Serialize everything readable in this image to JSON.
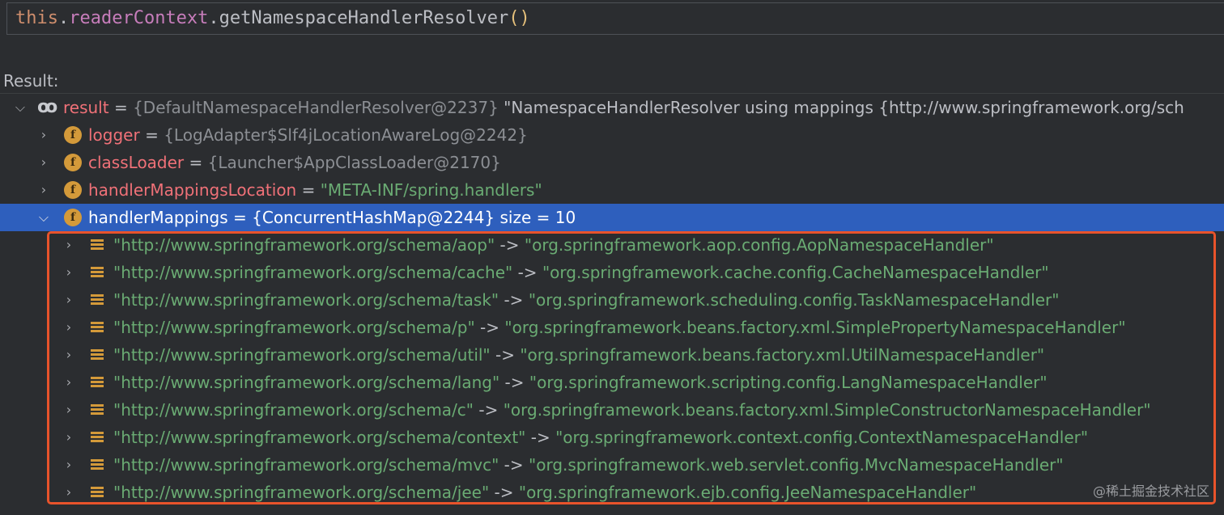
{
  "expression": {
    "this_kw": "this",
    "dot1": ".",
    "field": "readerContext",
    "dot2": ".",
    "method": "getNamespaceHandlerResolver",
    "parens": "()"
  },
  "result_label": "Result:",
  "root": {
    "name": "result",
    "eq": " = ",
    "ref": "{DefaultNamespaceHandlerResolver@2237}",
    "value": " \"NamespaceHandlerResolver using mappings {http://www.springframework.org/sch"
  },
  "fields": [
    {
      "name": "logger",
      "eq": " = ",
      "value": "{LogAdapter$Slf4jLocationAwareLog@2242}",
      "value_style": "gray"
    },
    {
      "name": "classLoader",
      "eq": " = ",
      "value": "{Launcher$AppClassLoader@2170}",
      "value_style": "gray"
    },
    {
      "name": "handlerMappingsLocation",
      "eq": " = ",
      "value": "\"META-INF/spring.handlers\"",
      "value_style": "green"
    }
  ],
  "selected": {
    "name": "handlerMappings",
    "eq": " = ",
    "ref": "{ConcurrentHashMap@2244}",
    "size": "  size = 10"
  },
  "entries": [
    {
      "key": "\"http://www.springframework.org/schema/aop\"",
      "arrow": " -> ",
      "value": "\"org.springframework.aop.config.AopNamespaceHandler\""
    },
    {
      "key": "\"http://www.springframework.org/schema/cache\"",
      "arrow": " -> ",
      "value": "\"org.springframework.cache.config.CacheNamespaceHandler\""
    },
    {
      "key": "\"http://www.springframework.org/schema/task\"",
      "arrow": " -> ",
      "value": "\"org.springframework.scheduling.config.TaskNamespaceHandler\""
    },
    {
      "key": "\"http://www.springframework.org/schema/p\"",
      "arrow": " -> ",
      "value": "\"org.springframework.beans.factory.xml.SimplePropertyNamespaceHandler\""
    },
    {
      "key": "\"http://www.springframework.org/schema/util\"",
      "arrow": " -> ",
      "value": "\"org.springframework.beans.factory.xml.UtilNamespaceHandler\""
    },
    {
      "key": "\"http://www.springframework.org/schema/lang\"",
      "arrow": " -> ",
      "value": "\"org.springframework.scripting.config.LangNamespaceHandler\""
    },
    {
      "key": "\"http://www.springframework.org/schema/c\"",
      "arrow": " -> ",
      "value": "\"org.springframework.beans.factory.xml.SimpleConstructorNamespaceHandler\""
    },
    {
      "key": "\"http://www.springframework.org/schema/context\"",
      "arrow": " -> ",
      "value": "\"org.springframework.context.config.ContextNamespaceHandler\""
    },
    {
      "key": "\"http://www.springframework.org/schema/mvc\"",
      "arrow": " -> ",
      "value": "\"org.springframework.web.servlet.config.MvcNamespaceHandler\""
    },
    {
      "key": "\"http://www.springframework.org/schema/jee\"",
      "arrow": " -> ",
      "value": "\"org.springframework.ejb.config.JeeNamespaceHandler\""
    }
  ],
  "icons": {
    "expand": "chevron-right-icon",
    "collapse": "chevron-down-icon",
    "field": "f",
    "watch": "glasses-icon",
    "entry": "map-entry-icon"
  },
  "colors": {
    "background": "#2b2d30",
    "selection": "#2e5fbd",
    "string": "#6aab73",
    "field_name": "#f07178",
    "highlight_border": "#e8532b"
  },
  "watermark": "@稀土掘金技术社区"
}
